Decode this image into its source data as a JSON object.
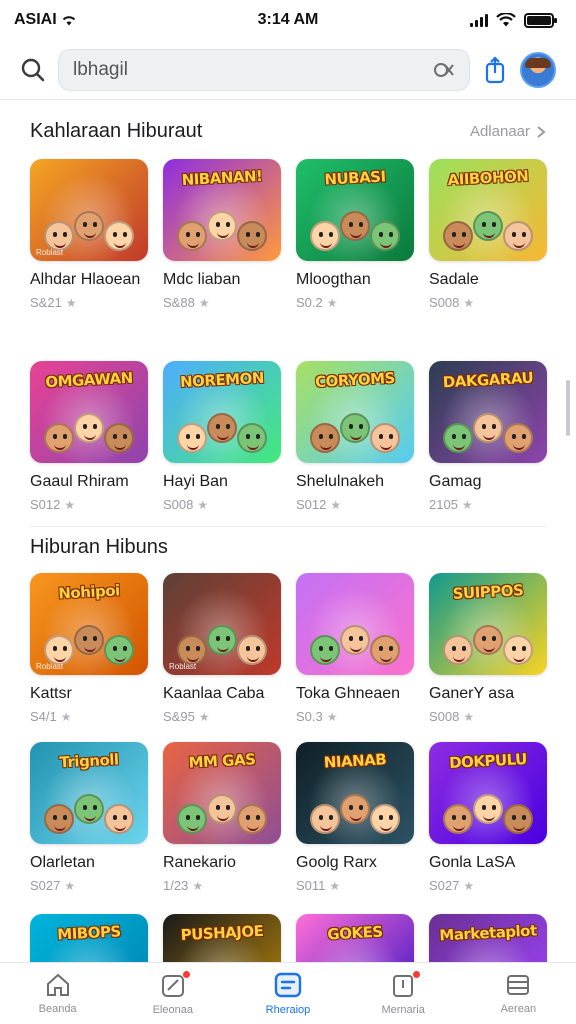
{
  "status_bar": {
    "carrier": "ASIAI",
    "time": "3:14 AM"
  },
  "search": {
    "value": "lbhagil",
    "placeholder": "lbhagil"
  },
  "sections": [
    {
      "title": "Kahlaraan Hiburaut",
      "see_all": "Adlanaar",
      "games": [
        {
          "name": "Alhdar Hlaoean",
          "rating": "S&21",
          "thumb_title": "",
          "colors": [
            "#f5a623",
            "#c0392b"
          ],
          "badge": "",
          "tag": "Roblast"
        },
        {
          "name": "Mdc liaban",
          "rating": "S&88",
          "thumb_title": "NIBANAN!",
          "colors": [
            "#8e2de2",
            "#ff9a3c"
          ],
          "badge": "•",
          "tag": ""
        },
        {
          "name": "Mloogthan",
          "rating": "S0.2",
          "thumb_title": "NUBASI",
          "colors": [
            "#1fbf6b",
            "#0b7a3b"
          ],
          "badge": "",
          "tag": ""
        },
        {
          "name": "Sadale",
          "rating": "S008",
          "thumb_title": "AIIBOHON",
          "colors": [
            "#9be15d",
            "#f7b733"
          ],
          "badge": "",
          "tag": ""
        }
      ]
    },
    {
      "title": "",
      "see_all": "",
      "games": [
        {
          "name": "Gaaul Rhiram",
          "rating": "S012",
          "thumb_title": "OMGAWAN",
          "colors": [
            "#e84393",
            "#8e44ad"
          ],
          "badge": "",
          "tag": ""
        },
        {
          "name": "Hayi Ban",
          "rating": "S008",
          "thumb_title": "NOREMON",
          "colors": [
            "#4facfe",
            "#43e97b"
          ],
          "badge": "",
          "tag": ""
        },
        {
          "name": "Shelulnakeh",
          "rating": "S012",
          "thumb_title": "CORYOMS",
          "colors": [
            "#a8e063",
            "#56ccf2"
          ],
          "badge": "",
          "tag": ""
        },
        {
          "name": "Gamag",
          "rating": "2105",
          "thumb_title": "DAKGARAU",
          "colors": [
            "#2c3e50",
            "#8e44ad"
          ],
          "badge": "",
          "tag": ""
        }
      ]
    },
    {
      "title": "Hiburan Hibuns",
      "see_all": "",
      "games": [
        {
          "name": "Kattsr",
          "rating": "S4/1",
          "thumb_title": "Nohipoi",
          "colors": [
            "#f7971e",
            "#d35400"
          ],
          "badge": "",
          "tag": "Roblast"
        },
        {
          "name": "Kaanlaa Caba",
          "rating": "S&95",
          "thumb_title": "",
          "colors": [
            "#5d4037",
            "#c0392b"
          ],
          "badge": "",
          "tag": "Roblast"
        },
        {
          "name": "Toka Ghneaen",
          "rating": "S0.3",
          "thumb_title": "",
          "colors": [
            "#c471f5",
            "#fa71cd"
          ],
          "badge": "",
          "tag": ""
        },
        {
          "name": "GanerY asa",
          "rating": "S008",
          "thumb_title": "SUIPPOS",
          "colors": [
            "#11998e",
            "#f9d423"
          ],
          "badge": "",
          "tag": ""
        }
      ]
    },
    {
      "title": "",
      "see_all": "",
      "games": [
        {
          "name": "Olarletan",
          "rating": "S027",
          "thumb_title": "Trignoll",
          "colors": [
            "#2193b0",
            "#6dd5ed"
          ],
          "badge": "",
          "tag": ""
        },
        {
          "name": "Ranekario",
          "rating": "1/23",
          "thumb_title": "MM GAS",
          "colors": [
            "#e96443",
            "#904e95"
          ],
          "badge": "",
          "tag": ""
        },
        {
          "name": "Goolg Rarx",
          "rating": "S011",
          "thumb_title": "NIANAB",
          "colors": [
            "#0f2027",
            "#2c5364"
          ],
          "badge": "",
          "tag": ""
        },
        {
          "name": "Gonla LaSA",
          "rating": "S027",
          "thumb_title": "DOKPULU",
          "colors": [
            "#8e2de2",
            "#4a00e0"
          ],
          "badge": "",
          "tag": ""
        }
      ]
    },
    {
      "title": "",
      "see_all": "",
      "games": [
        {
          "name": "",
          "rating": "",
          "thumb_title": "MIBOPS",
          "colors": [
            "#00b4db",
            "#0083b0"
          ],
          "badge": "",
          "tag": ""
        },
        {
          "name": "",
          "rating": "",
          "thumb_title": "PUSHAJOE",
          "colors": [
            "#1a1a1a",
            "#b8860b"
          ],
          "badge": "",
          "tag": ""
        },
        {
          "name": "",
          "rating": "",
          "thumb_title": "GOKES",
          "colors": [
            "#ff6fd8",
            "#3813c2"
          ],
          "badge": "",
          "tag": ""
        },
        {
          "name": "",
          "rating": "",
          "thumb_title": "Marketaplot",
          "colors": [
            "#6a3093",
            "#a044ff"
          ],
          "badge": "",
          "tag": ""
        }
      ]
    }
  ],
  "tab_bar": {
    "items": [
      {
        "label": "Beanda",
        "icon": "home-icon",
        "active": false,
        "dot": false
      },
      {
        "label": "Eleonaa",
        "icon": "games-icon",
        "active": false,
        "dot": true
      },
      {
        "label": "Rheraiop",
        "icon": "apps-icon",
        "active": true,
        "dot": false
      },
      {
        "label": "Mernaria",
        "icon": "updates-icon",
        "active": false,
        "dot": true
      },
      {
        "label": "Aerean",
        "icon": "menu-icon",
        "active": false,
        "dot": false
      }
    ],
    "accent": "#1a73e8"
  }
}
